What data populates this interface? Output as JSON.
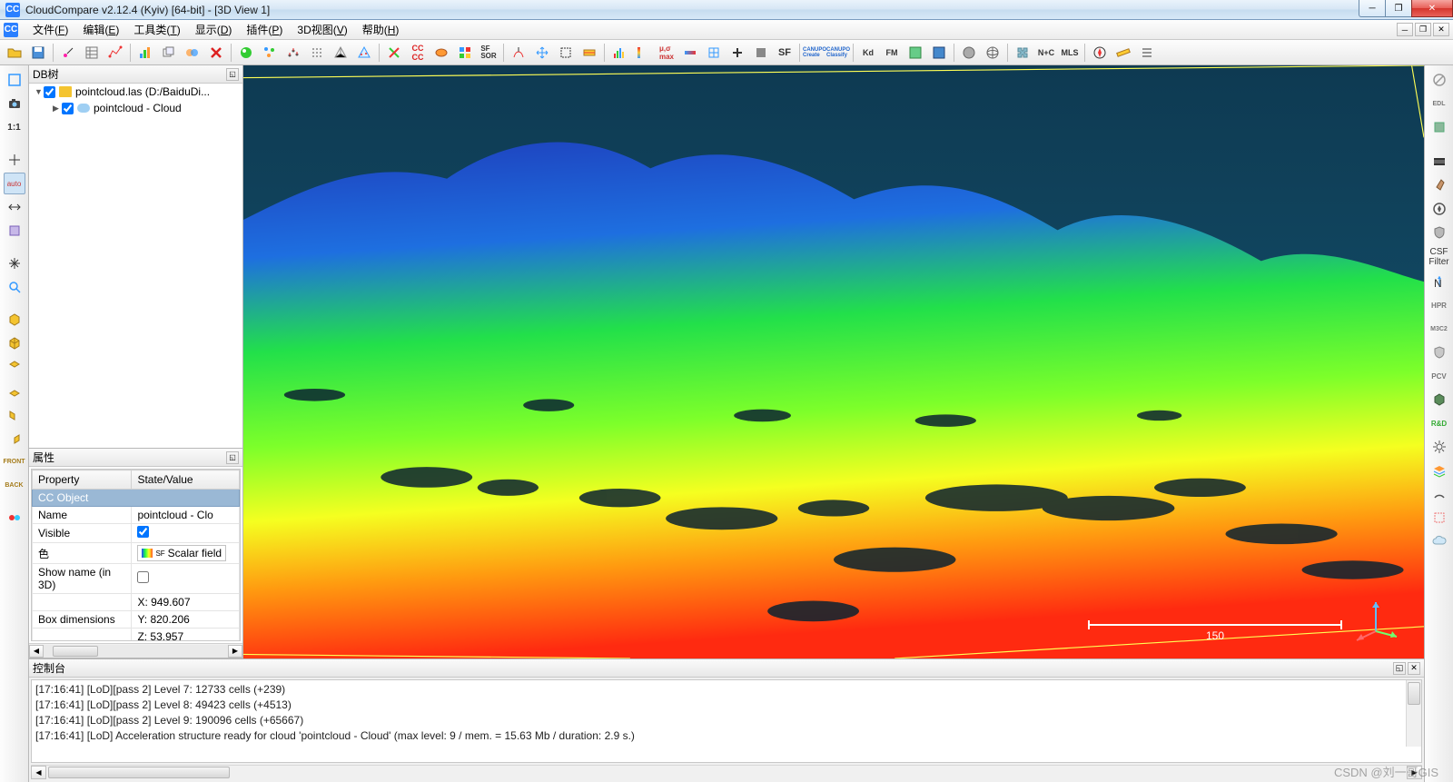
{
  "window": {
    "title": "CloudCompare v2.12.4 (Kyiv) [64-bit] - [3D View 1]",
    "icon_text": "CC"
  },
  "menu": {
    "items": [
      {
        "label": "文件",
        "key": "F"
      },
      {
        "label": "编辑",
        "key": "E"
      },
      {
        "label": "工具类",
        "key": "T"
      },
      {
        "label": "显示",
        "key": "D"
      },
      {
        "label": "插件",
        "key": "P"
      },
      {
        "label": "3D视图",
        "key": "V"
      },
      {
        "label": "帮助",
        "key": "H"
      }
    ]
  },
  "panels": {
    "db_title": "DB树",
    "props_title": "属性",
    "console_title": "控制台"
  },
  "tree": {
    "root_label": "pointcloud.las (D:/BaiduDi...",
    "child_label": "pointcloud - Cloud"
  },
  "props": {
    "header_property": "Property",
    "header_value": "State/Value",
    "section": "CC Object",
    "rows": [
      {
        "k": "Name",
        "v": "pointcloud - Clo"
      },
      {
        "k": "Visible",
        "v": "__checkbox__"
      },
      {
        "k": "色",
        "v": "__sf__"
      },
      {
        "k": "Show name (in 3D)",
        "v": "__checkbox_off__"
      },
      {
        "k": "",
        "v": "X: 949.607"
      },
      {
        "k": "Box dimensions",
        "v": "Y: 820.206"
      },
      {
        "k": "",
        "v": "Z: 53.957"
      }
    ],
    "scalar_field_label": "Scalar field"
  },
  "console": {
    "lines": [
      "[17:16:41] [LoD][pass 2] Level 7: 12733 cells (+239)",
      "[17:16:41] [LoD][pass 2] Level 8: 49423 cells (+4513)",
      "[17:16:41] [LoD][pass 2] Level 9: 190096 cells (+65667)",
      "[17:16:41] [LoD] Acceleration structure ready for cloud 'pointcloud - Cloud' (max level: 9 / mem. = 15.63 Mb / duration: 2.9 s.)"
    ]
  },
  "viewport": {
    "scale_value": "150"
  },
  "right_toolbar": {
    "csf_label": "CSF Filter"
  },
  "watermark": "CSDN @刘一哥GIS"
}
